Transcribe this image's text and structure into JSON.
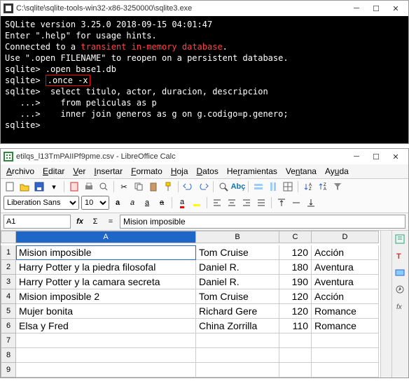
{
  "term_win": {
    "title": "C:\\sqlite\\sqlite-tools-win32-x86-3250000\\sqlite3.exe",
    "lines": {
      "l0": "SQLite version 3.25.0 2018-09-15 04:01:47",
      "l1": "Enter \".help\" for usage hints.",
      "l2a": "Connected to a ",
      "l2b": "transient in-memory database",
      "l2c": ".",
      "l3": "Use \".open FILENAME\" to reopen on a persistent database.",
      "l4": "sqlite> .open base1.db",
      "l5a": "sqlite> ",
      "l5b": ".once -x",
      "l6": "sqlite>  select titulo, actor, duracion, descripcion",
      "l7": "   ...>    from peliculas as p",
      "l8": "   ...>    inner join generos as g on g.codigo=p.genero;",
      "l9": "sqlite>"
    }
  },
  "calc_win": {
    "title": "etilqs_l13TmPAIIPf9pme.csv - LibreOffice Calc",
    "menu": [
      "Archivo",
      "Editar",
      "Ver",
      "Insertar",
      "Formato",
      "Hoja",
      "Datos",
      "Herramientas",
      "Ventana",
      "Ayuda"
    ],
    "font": {
      "name": "Liberation Sans",
      "size": "10"
    },
    "cellref": "A1",
    "formula": "Mision imposible",
    "headers": [
      "A",
      "B",
      "C",
      "D"
    ],
    "rows": [
      {
        "n": "1",
        "a": "Mision imposible",
        "b": "Tom Cruise",
        "c": "120",
        "d": "Acción"
      },
      {
        "n": "2",
        "a": "Harry Potter y la piedra filosofal",
        "b": "Daniel R.",
        "c": "180",
        "d": "Aventura"
      },
      {
        "n": "3",
        "a": "Harry Potter y la camara secreta",
        "b": "Daniel R.",
        "c": "190",
        "d": "Aventura"
      },
      {
        "n": "4",
        "a": "Mision imposible 2",
        "b": "Tom Cruise",
        "c": "120",
        "d": "Acción"
      },
      {
        "n": "5",
        "a": "Mujer bonita",
        "b": "Richard Gere",
        "c": "120",
        "d": "Romance"
      },
      {
        "n": "6",
        "a": "Elsa y Fred",
        "b": "China Zorrilla",
        "c": "110",
        "d": "Romance"
      },
      {
        "n": "7",
        "a": "",
        "b": "",
        "c": "",
        "d": ""
      },
      {
        "n": "8",
        "a": "",
        "b": "",
        "c": "",
        "d": ""
      },
      {
        "n": "9",
        "a": "",
        "b": "",
        "c": "",
        "d": ""
      }
    ]
  },
  "chart_data": {
    "type": "table",
    "headers": [
      "titulo",
      "actor",
      "duracion",
      "descripcion"
    ],
    "rows": [
      [
        "Mision imposible",
        "Tom Cruise",
        120,
        "Acción"
      ],
      [
        "Harry Potter y la piedra filosofal",
        "Daniel R.",
        180,
        "Aventura"
      ],
      [
        "Harry Potter y la camara secreta",
        "Daniel R.",
        190,
        "Aventura"
      ],
      [
        "Mision imposible 2",
        "Tom Cruise",
        120,
        "Acción"
      ],
      [
        "Mujer bonita",
        "Richard Gere",
        120,
        "Romance"
      ],
      [
        "Elsa y Fred",
        "China Zorrilla",
        110,
        "Romance"
      ]
    ]
  }
}
